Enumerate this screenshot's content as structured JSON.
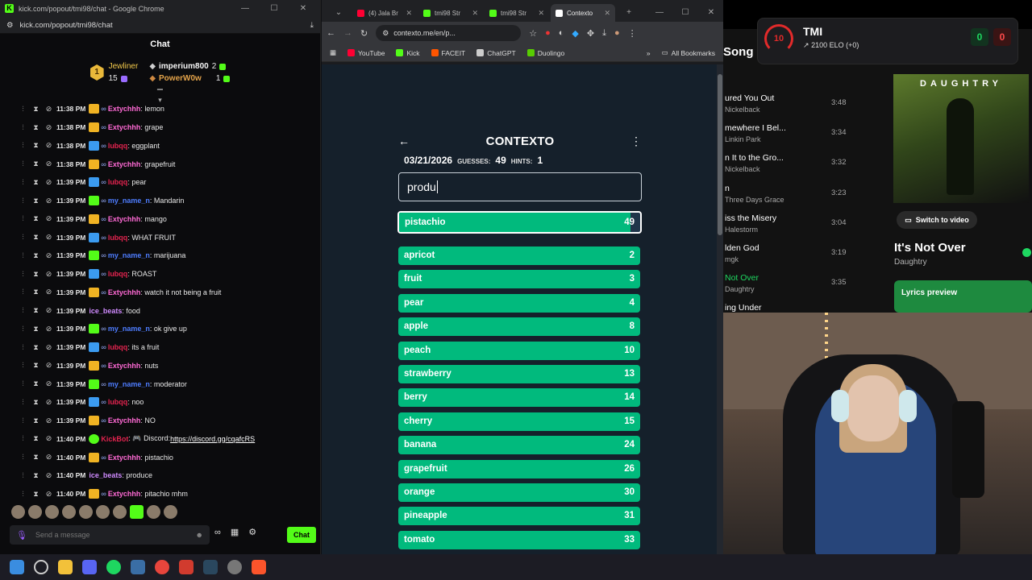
{
  "chat_window": {
    "title": "kick.com/popout/tmi98/chat - Google Chrome",
    "url": "kick.com/popout/tmi98/chat",
    "header": "Chat",
    "leaderboard": {
      "top_gifter": {
        "rank": "1",
        "name": "Jewliner",
        "count": "15"
      },
      "entries": [
        {
          "name": "imperium800",
          "count": "2"
        },
        {
          "name": "PowerW0w",
          "count": "1"
        }
      ]
    },
    "messages": [
      {
        "time": "11:38 PM",
        "badge": "crown",
        "user": "Extychhh",
        "color": "#ff6ad5",
        "text": ": lemon"
      },
      {
        "time": "11:38 PM",
        "badge": "crown",
        "user": "Extychhh",
        "color": "#ff6ad5",
        "text": ": grape"
      },
      {
        "time": "11:38 PM",
        "badge": "sword",
        "user": "lubqq",
        "color": "#e0234e",
        "text": ": eggplant"
      },
      {
        "time": "11:38 PM",
        "badge": "crown",
        "user": "Extychhh",
        "color": "#ff6ad5",
        "text": ": grapefruit"
      },
      {
        "time": "11:39 PM",
        "badge": "sword",
        "user": "lubqq",
        "color": "#e0234e",
        "text": ": pear"
      },
      {
        "time": "11:39 PM",
        "badge": "gift",
        "user": "my_name_n",
        "color": "#4e7dff",
        "text": ": Mandarin"
      },
      {
        "time": "11:39 PM",
        "badge": "crown",
        "user": "Extychhh",
        "color": "#ff6ad5",
        "text": ": mango"
      },
      {
        "time": "11:39 PM",
        "badge": "sword",
        "user": "lubqq",
        "color": "#e0234e",
        "text": ": WHAT FRUIT"
      },
      {
        "time": "11:39 PM",
        "badge": "gift",
        "user": "my_name_n",
        "color": "#4e7dff",
        "text": ": marijuana"
      },
      {
        "time": "11:39 PM",
        "badge": "sword",
        "user": "lubqq",
        "color": "#e0234e",
        "text": ": ROAST"
      },
      {
        "time": "11:39 PM",
        "badge": "crown",
        "user": "Extychhh",
        "color": "#ff6ad5",
        "text": ": watch it not being a fruit"
      },
      {
        "time": "11:39 PM",
        "badge": "",
        "user": "ice_beats",
        "color": "#d08bff",
        "text": ": food"
      },
      {
        "time": "11:39 PM",
        "badge": "gift",
        "user": "my_name_n",
        "color": "#4e7dff",
        "text": ": ok give up"
      },
      {
        "time": "11:39 PM",
        "badge": "sword",
        "user": "lubqq",
        "color": "#e0234e",
        "text": ": its a fruit"
      },
      {
        "time": "11:39 PM",
        "badge": "crown",
        "user": "Extychhh",
        "color": "#ff6ad5",
        "text": ": nuts"
      },
      {
        "time": "11:39 PM",
        "badge": "gift",
        "user": "my_name_n",
        "color": "#4e7dff",
        "text": ": moderator"
      },
      {
        "time": "11:39 PM",
        "badge": "sword",
        "user": "lubqq",
        "color": "#e0234e",
        "text": ": noo"
      },
      {
        "time": "11:39 PM",
        "badge": "crown",
        "user": "Extychhh",
        "color": "#ff6ad5",
        "text": ": NO"
      },
      {
        "time": "11:40 PM",
        "badge": "bot",
        "user": "KickBot",
        "color": "#e0234e",
        "text": ": 🎮 Discord: ",
        "link": "https://discord.gg/cqafcRS"
      },
      {
        "time": "11:40 PM",
        "badge": "crown",
        "user": "Extychhh",
        "color": "#ff6ad5",
        "text": ": pistachio"
      },
      {
        "time": "11:40 PM",
        "badge": "",
        "user": "ice_beats",
        "color": "#d08bff",
        "text": ": produce"
      },
      {
        "time": "11:40 PM",
        "badge": "crown",
        "user": "Extychhh",
        "color": "#ff6ad5",
        "text": ": pitachio mhm"
      }
    ],
    "composer_placeholder": "Send a message",
    "chat_button": "Chat"
  },
  "browser": {
    "tabs": [
      {
        "label": "(4) Jala Br",
        "color": "#ff0033"
      },
      {
        "label": "tmi98 Str",
        "color": "#53fc18"
      },
      {
        "label": "tmi98 Str",
        "color": "#53fc18"
      },
      {
        "label": "Contexto",
        "color": "#ffffff",
        "active": true
      }
    ],
    "url": "contexto.me/en/p...",
    "bookmarks": [
      {
        "label": "YouTube",
        "color": "#ff0033"
      },
      {
        "label": "Kick",
        "color": "#53fc18"
      },
      {
        "label": "FACEIT",
        "color": "#ff5500"
      },
      {
        "label": "ChatGPT",
        "color": "#cccccc"
      },
      {
        "label": "Duolingo",
        "color": "#58cc02"
      }
    ],
    "all_bookmarks": "All Bookmarks"
  },
  "contexto": {
    "title": "CONTEXTO",
    "date": "03/21/2026",
    "guesses_label": "GUESSES:",
    "guesses": "49",
    "hints_label": "HINTS:",
    "hints": "1",
    "input_value": "produ",
    "latest": {
      "word": "pistachio",
      "rank": 49,
      "progress": 0.96
    },
    "guesses_list": [
      {
        "word": "apricot",
        "rank": 2
      },
      {
        "word": "fruit",
        "rank": 3
      },
      {
        "word": "pear",
        "rank": 4
      },
      {
        "word": "apple",
        "rank": 8
      },
      {
        "word": "peach",
        "rank": 10
      },
      {
        "word": "strawberry",
        "rank": 13
      },
      {
        "word": "berry",
        "rank": 14
      },
      {
        "word": "cherry",
        "rank": 15
      },
      {
        "word": "banana",
        "rank": 24
      },
      {
        "word": "grapefruit",
        "rank": 26
      },
      {
        "word": "orange",
        "rank": 30
      },
      {
        "word": "pineapple",
        "rank": 31
      },
      {
        "word": "tomato",
        "rank": 33
      }
    ]
  },
  "spotify": {
    "heading": "Song",
    "tracks": [
      {
        "title": "ured You Out",
        "artist": "Nickelback",
        "duration": "3:48"
      },
      {
        "title": "mewhere I Bel...",
        "artist": "Linkin Park",
        "duration": "3:34"
      },
      {
        "title": "n It to the Gro...",
        "artist": "Nickelback",
        "duration": "3:32"
      },
      {
        "title": "n",
        "artist": "Three Days Grace",
        "duration": "3:23"
      },
      {
        "title": "iss the Misery",
        "artist": "Halestorm",
        "duration": "3:04"
      },
      {
        "title": "lden God",
        "artist": "mgk",
        "duration": "3:19"
      },
      {
        "title": "Not Over",
        "artist": "Daughtry",
        "duration": "3:35",
        "playing": true
      },
      {
        "title": "ing Under",
        "artist": "",
        "duration": ""
      }
    ],
    "album_band": "DAUGHTRY",
    "switch_label": "Switch to video",
    "now_playing_title": "It's Not Over",
    "now_playing_artist": "Daughtry",
    "lyrics_label": "Lyrics preview"
  },
  "faceit_overlay": {
    "level": "10",
    "name": "TMI",
    "elo": "2100 ELO (+0)",
    "wins": "0",
    "losses": "0"
  }
}
